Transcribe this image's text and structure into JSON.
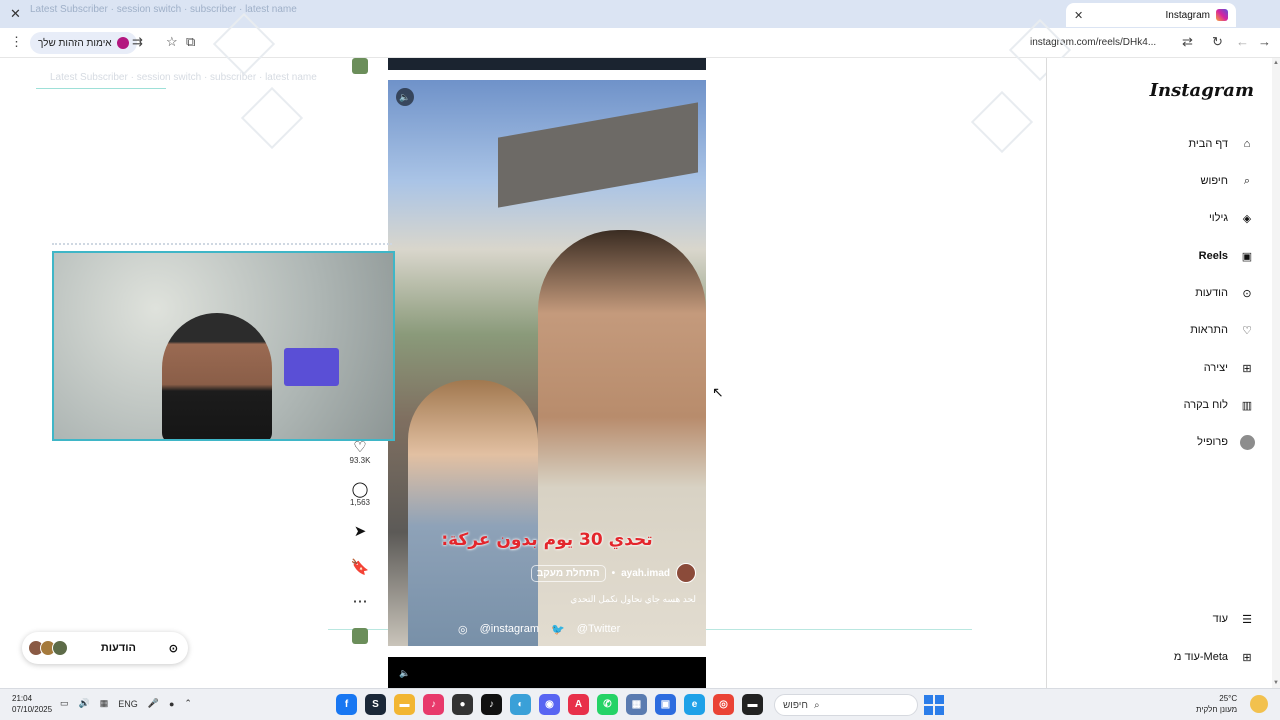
{
  "browser": {
    "tab_title": "Instagram",
    "tab_ghost_text": "Latest Subscriber · session switch · subscriber · latest name",
    "tab_close": "✕",
    "new_tab": "+",
    "window_close": "✕",
    "url": "instagram.com/reels/DHk4...",
    "profile_chip_label": "אימות הזהות שלך"
  },
  "overlay": {
    "text_line": "Latest Subscriber · session switch · subscriber · latest name"
  },
  "sidebar": {
    "logo": "Instagram",
    "items": [
      {
        "label": "דף הבית",
        "icon": "home-icon"
      },
      {
        "label": "חיפוש",
        "icon": "search-icon"
      },
      {
        "label": "גילוי",
        "icon": "compass-icon"
      },
      {
        "label": "Reels",
        "icon": "reels-icon"
      },
      {
        "label": "הודעות",
        "icon": "messenger-icon"
      },
      {
        "label": "התראות",
        "icon": "heart-icon"
      },
      {
        "label": "יצירה",
        "icon": "plus-square-icon"
      },
      {
        "label": "לוח בקרה",
        "icon": "chart-icon"
      },
      {
        "label": "פרופיל",
        "icon": "avatar-icon"
      }
    ],
    "more_label": "עוד",
    "also_meta_label": "עוד מ-Meta"
  },
  "reel": {
    "caption_title": "تحدي 30 يوم بدون عركة:",
    "author": "ayah.imad",
    "follow_label": "התחלת מעקב",
    "description": "لحد هسه جاي نحاول نكمل التحدي",
    "social_instagram": "@instagram",
    "social_twitter": "@Twitter"
  },
  "actions": {
    "likes": "93.3K",
    "comments": "1,563"
  },
  "messages_pill": {
    "label": "הודעות"
  },
  "taskbar": {
    "time": "21:04",
    "date": "07/10/2025",
    "lang": "ENG",
    "search_placeholder": "חיפוש",
    "weather_temp": "25°C",
    "weather_desc": "מעונן חלקית"
  }
}
